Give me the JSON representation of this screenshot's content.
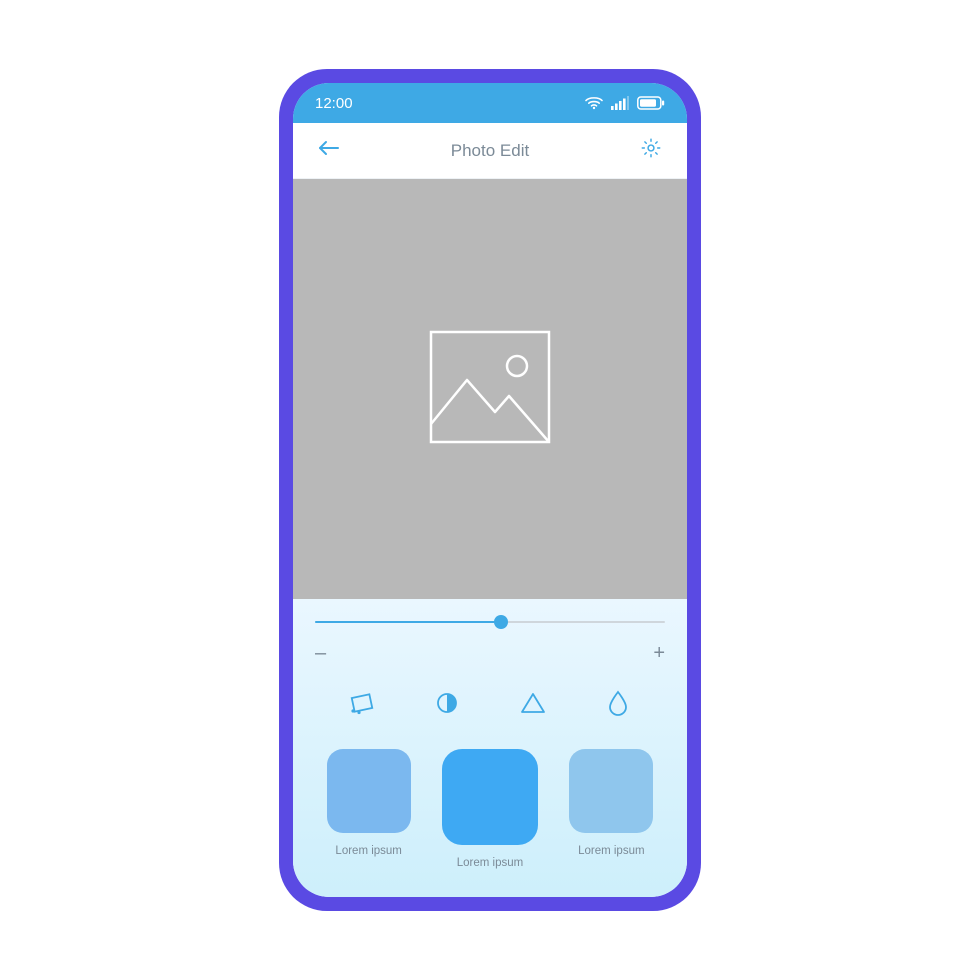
{
  "status": {
    "time": "12:00"
  },
  "header": {
    "title": "Photo Edit"
  },
  "slider": {
    "minus": "–",
    "plus": "+"
  },
  "tools": [
    {
      "name": "crop"
    },
    {
      "name": "contrast"
    },
    {
      "name": "sharpen"
    },
    {
      "name": "blur"
    }
  ],
  "filters": [
    {
      "label": "Lorem ipsum",
      "color": "#7bb8ef"
    },
    {
      "label": "Lorem ipsum",
      "color": "#3ea9f3"
    },
    {
      "label": "Lorem ipsum",
      "color": "#8fc6ed"
    }
  ],
  "colors": {
    "accent": "#3ea9e5",
    "frame": "#5a4ae3",
    "photo_bg": "#b8b8b8"
  }
}
